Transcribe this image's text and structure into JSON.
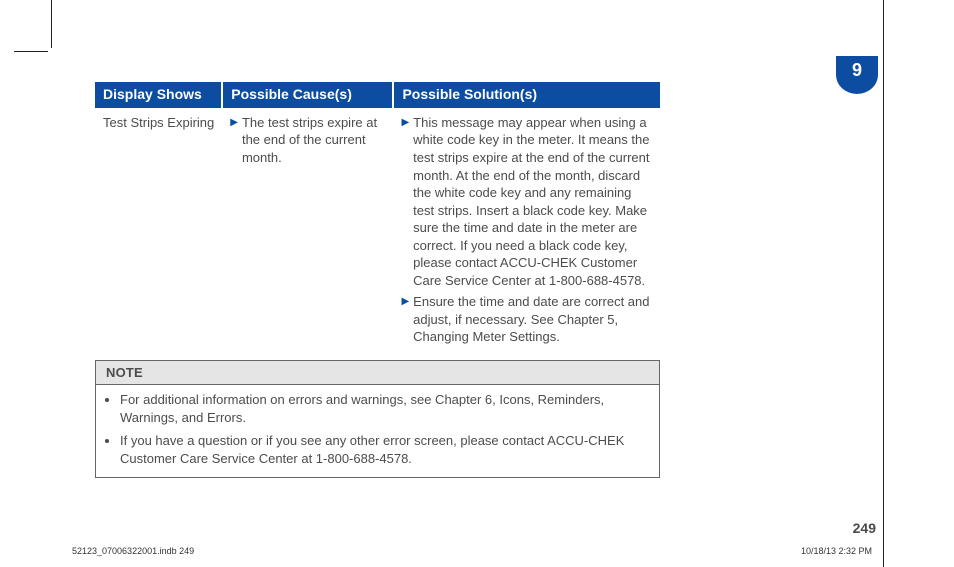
{
  "chapter_tab": "9",
  "table": {
    "headers": [
      "Display Shows",
      "Possible Cause(s)",
      "Possible Solution(s)"
    ],
    "row": {
      "display": "Test Strips Expiring",
      "causes": [
        "The test strips expire at the end of the current month."
      ],
      "solutions": [
        "This message may appear when using a white code key in the meter. It means the test strips expire at the end of the current month. At the end of the month, discard the white code key and any remaining test strips. Insert a black code key. Make sure the time and date in the meter are correct. If you need a black code key, please contact ACCU-CHEK Customer Care Service Center at 1-800-688-4578.",
        "Ensure the time and date are correct and adjust, if necessary. See Chapter 5, Changing Meter Settings."
      ]
    }
  },
  "note": {
    "heading": "NOTE",
    "items": [
      "For additional information on errors and warnings, see Chapter 6, Icons, Reminders, Warnings, and Errors.",
      "If you have a question or if you see any other error screen, please contact ACCU-CHEK Customer Care Service Center at 1-800-688-4578."
    ]
  },
  "page_number": "249",
  "footer": {
    "left": "52123_07006322001.indb   249",
    "right": "10/18/13   2:32 PM"
  }
}
